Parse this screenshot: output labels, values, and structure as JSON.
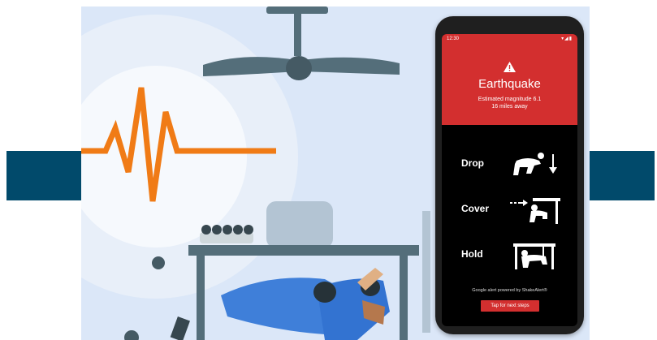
{
  "phone": {
    "status_time": "12:30",
    "status_icons": "▾◢▮",
    "alert": {
      "title": "Earthquake",
      "magnitude_line": "Estimated magnitude 6.1",
      "distance_line": "16 miles away"
    },
    "steps": [
      {
        "label": "Drop",
        "icon": "drop-pose-icon"
      },
      {
        "label": "Cover",
        "icon": "cover-pose-icon"
      },
      {
        "label": "Hold",
        "icon": "hold-pose-icon"
      }
    ],
    "footer_note": "Google alert powered by ShakeAlert®",
    "next_button": "Tap for next steps"
  },
  "colors": {
    "alert_red": "#d32f2f",
    "seismic_orange": "#f07b16",
    "banner_navy": "#014a6b",
    "scene_background": "#dbe7f8"
  }
}
